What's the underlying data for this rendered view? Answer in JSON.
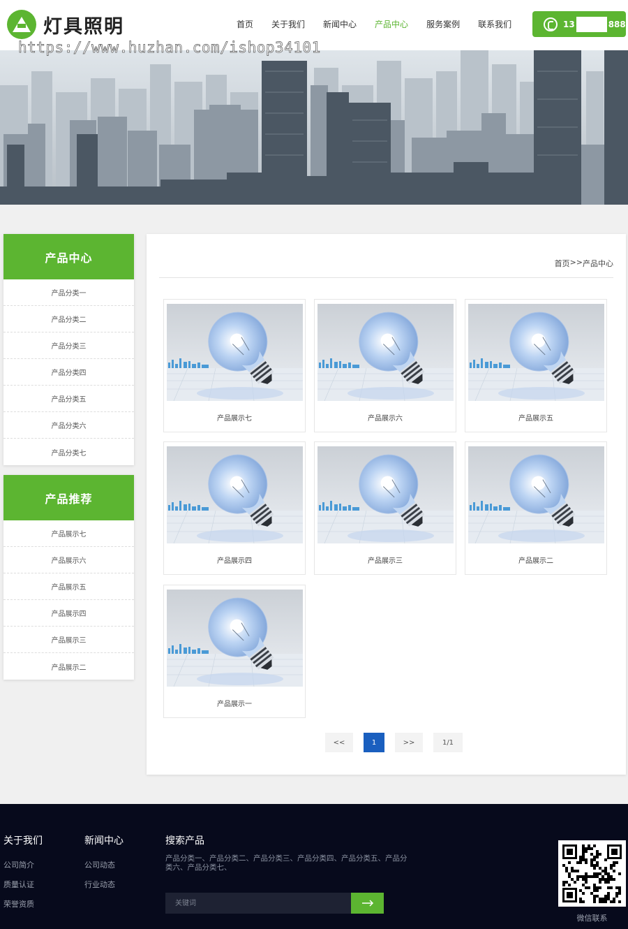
{
  "header": {
    "logo_text": "灯具照明",
    "watermark": "https://www.huzhan.com/ishop34101",
    "nav": [
      "首页",
      "关于我们",
      "新闻中心",
      "产品中心",
      "服务案例",
      "联系我们"
    ],
    "nav_active": "产品中心",
    "phone_prefix": "13",
    "phone_suffix": "888"
  },
  "sidebar": {
    "categories_title": "产品中心",
    "categories": [
      "产品分类一",
      "产品分类二",
      "产品分类三",
      "产品分类四",
      "产品分类五",
      "产品分类六",
      "产品分类七"
    ],
    "recommend_title": "产品推荐",
    "recommend": [
      "产品展示七",
      "产品展示六",
      "产品展示五",
      "产品展示四",
      "产品展示三",
      "产品展示二"
    ]
  },
  "breadcrumb": {
    "home": "首页",
    "sep": ">>",
    "current": "产品中心"
  },
  "products": [
    "产品展示七",
    "产品展示六",
    "产品展示五",
    "产品展示四",
    "产品展示三",
    "产品展示二",
    "产品展示一"
  ],
  "pagination": {
    "prev": "<<",
    "current": "1",
    "next": ">>",
    "summary": "1/1"
  },
  "footer": {
    "about_title": "关于我们",
    "about_links": [
      "公司简介",
      "质量认证",
      "荣誉资质"
    ],
    "news_title": "新闻中心",
    "news_links": [
      "公司动态",
      "行业动态"
    ],
    "search_title": "搜索产品",
    "search_text": "产品分类一、产品分类二、产品分类三、产品分类四、产品分类五、产品分类六、产品分类七、",
    "search_placeholder": "关键词",
    "qr_label": "微信联系"
  },
  "colors": {
    "brand_green": "#5cb531",
    "footer_bg": "#070a1c",
    "pager_active": "#1a5fbf"
  }
}
